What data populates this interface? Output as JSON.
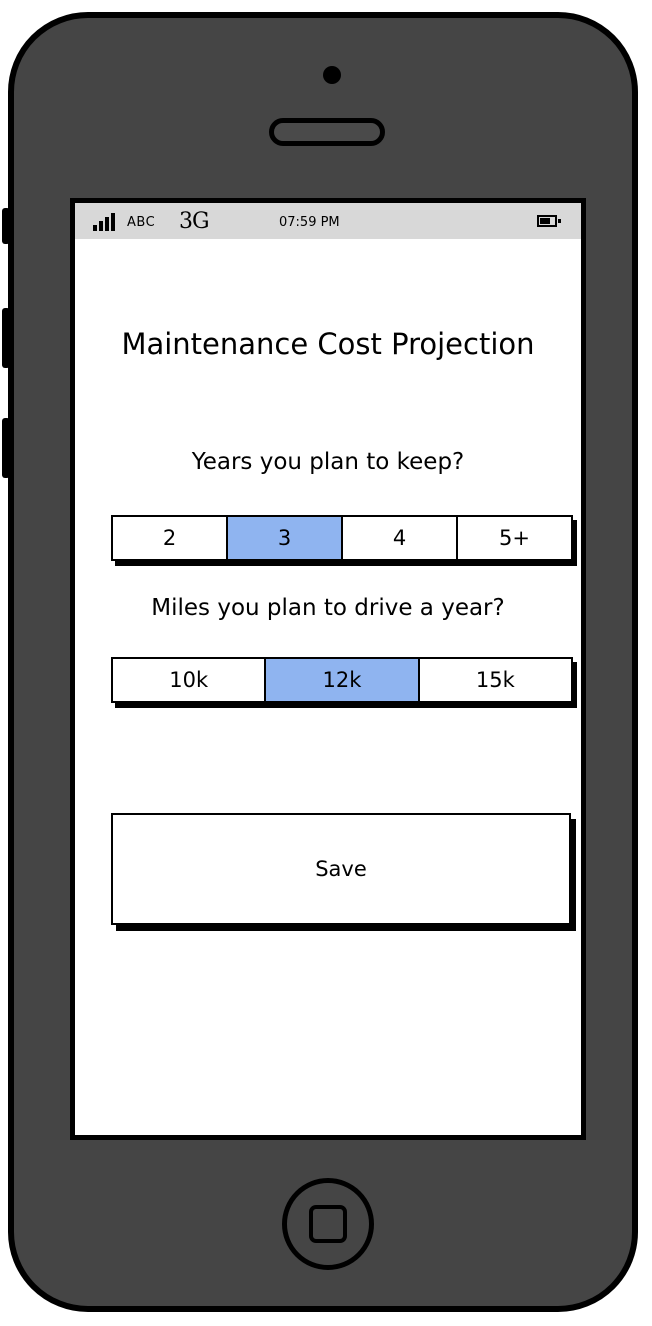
{
  "status_bar": {
    "carrier": "ABC",
    "network": "3G",
    "time": "07:59 PM"
  },
  "title": "Maintenance Cost Projection",
  "years": {
    "question": "Years you plan to keep?",
    "options": [
      "2",
      "3",
      "4",
      "5+"
    ],
    "selected": "3"
  },
  "miles": {
    "question": "Miles you plan to drive a year?",
    "options": [
      "10k",
      "12k",
      "15k"
    ],
    "selected": "12k"
  },
  "save_label": "Save",
  "colors": {
    "selected_segment": "#8fb4f0",
    "phone_body": "#454545",
    "status_bar": "#d8d8d8"
  },
  "icons": {
    "signal": "signal-bars-icon",
    "battery": "battery-icon",
    "home": "home-button-icon"
  }
}
